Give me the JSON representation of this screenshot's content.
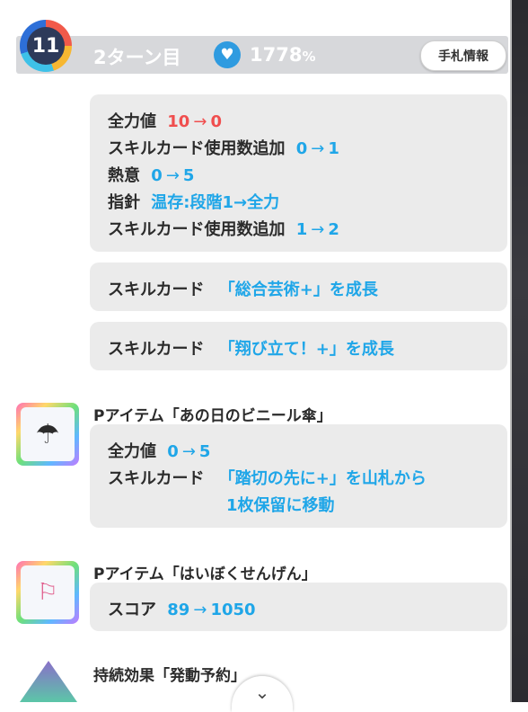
{
  "header": {
    "turn_number": "11",
    "turn_label": "2ターン目",
    "hp_value": "1778",
    "hp_unit": "%",
    "hand_button": "手札情報"
  },
  "card1": {
    "lines": [
      {
        "label": "全力値",
        "from": "10",
        "arrow": "→",
        "to": "0"
      },
      {
        "label": "スキルカード使用数追加",
        "from": "0",
        "arrow": "→",
        "to": "1"
      },
      {
        "label": "熱意",
        "from": "0",
        "arrow": "→",
        "to": "5"
      },
      {
        "label": "指針",
        "value": "温存:段階1→全力"
      },
      {
        "label": "スキルカード使用数追加",
        "from": "1",
        "arrow": "→",
        "to": "2"
      }
    ]
  },
  "card2": {
    "label": "スキルカード",
    "value": "「総合芸術+」を成長"
  },
  "card3": {
    "label": "スキルカード",
    "value": "「翔び立て！+」を成長"
  },
  "item1": {
    "title": "Pアイテム「あの日のビニール傘」",
    "icon": "umbrella-icon",
    "lines": [
      {
        "label": "全力値",
        "from": "0",
        "arrow": "→",
        "to": "5"
      },
      {
        "label": "スキルカード",
        "value_line1": "「踏切の先に+」を山札から",
        "value_line2": "1枚保留に移動"
      }
    ]
  },
  "item2": {
    "title": "Pアイテム「はいぼくせんげん」",
    "icon": "white-flag-icon",
    "lines": [
      {
        "label": "スコア",
        "from": "89",
        "arrow": "→",
        "to": "1050"
      }
    ]
  },
  "effect": {
    "title": "持続効果「発動予約」",
    "icon": "effect-icon"
  },
  "colors": {
    "accent_blue": "#1fa6e8",
    "accent_red": "#f04e4e",
    "header_bg": "#d7d8db",
    "card_bg": "#ebebeb"
  }
}
